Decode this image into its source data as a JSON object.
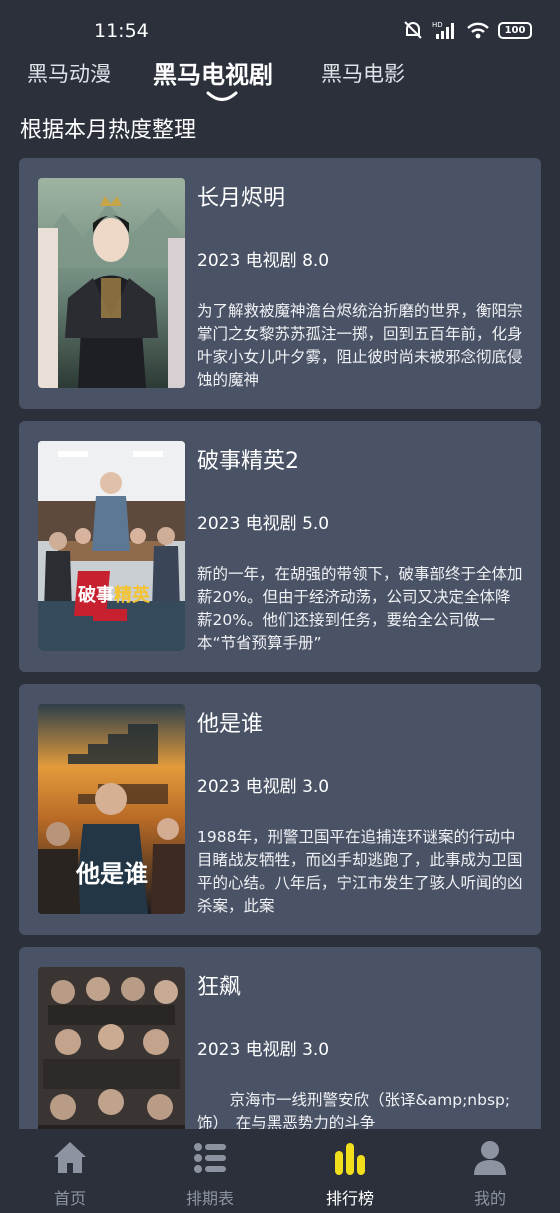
{
  "status": {
    "time": "11:54",
    "battery": "100"
  },
  "tabs": [
    {
      "label": "黑马动漫"
    },
    {
      "label": "黑马电视剧"
    },
    {
      "label": "黑马电影"
    }
  ],
  "section_title": "根据本月热度整理",
  "cards": [
    {
      "title": "长月烬明",
      "meta": "2023 电视剧 8.0",
      "desc": "为了解救被魔神澹台烬统治折磨的世界，衡阳宗掌门之女黎苏苏孤注一掷，回到五百年前，化身叶家小女儿叶夕雾，阻止彼时尚未被邪念彻底侵蚀的魔神"
    },
    {
      "title": "破事精英2",
      "meta": "2023 电视剧 5.0",
      "desc": "新的一年，在胡强的带领下，破事部终于全体加薪20%。但由于经济动荡，公司又决定全体降薪20%。他们还接到任务，要给全公司做一本“节省预算手册”"
    },
    {
      "title": "他是谁",
      "meta": "2023 电视剧 3.0",
      "desc": "1988年，刑警卫国平在追捕连环谜案的行动中目睹战友牺牲，而凶手却逃跑了，此事成为卫国平的心结。八年后，宁江市发生了骇人听闻的凶杀案，此案"
    },
    {
      "title": "狂飙",
      "meta": "2023 电视剧 3.0",
      "desc": "京海市一线刑警安欣（张译&amp;nbsp;饰）　在与黑恶势力的斗争"
    }
  ],
  "poster_icons": [
    "poster-changyuejinming",
    "poster-poshijingying",
    "poster-tashishui",
    "poster-kuangbiao"
  ],
  "nav": [
    {
      "label": "首页",
      "icon": "home-icon"
    },
    {
      "label": "排期表",
      "icon": "schedule-list-icon"
    },
    {
      "label": "排行榜",
      "icon": "ranking-bars-icon"
    },
    {
      "label": "我的",
      "icon": "user-icon"
    }
  ],
  "colors": {
    "background": "#2b303b",
    "card": "#4a5366",
    "accent": "#f2df1c",
    "nav_inactive": "#8d93a0"
  }
}
